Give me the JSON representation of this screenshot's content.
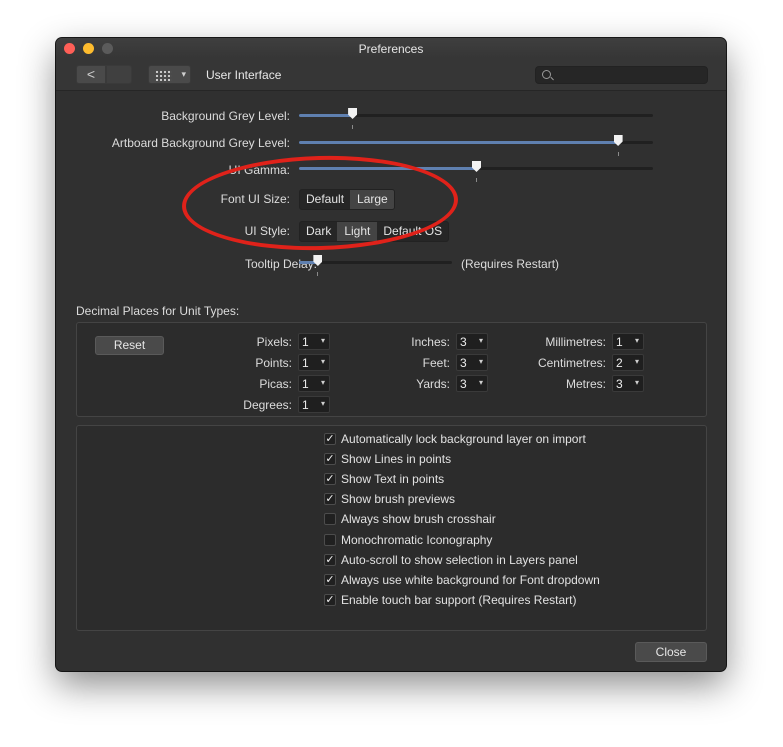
{
  "window": {
    "title": "Preferences"
  },
  "toolbar": {
    "section": "User Interface",
    "back_glyph": "<",
    "grid_caret": "▾",
    "search_placeholder": ""
  },
  "sliders": {
    "background_grey": {
      "label": "Background Grey Level:",
      "value": 0.15
    },
    "artboard_grey": {
      "label": "Artboard Background Grey Level:",
      "value": 0.9
    },
    "ui_gamma": {
      "label": "UI Gamma:",
      "value": 0.5
    },
    "tooltip_delay": {
      "label": "Tooltip Delay:",
      "value": 0.12,
      "note": "(Requires Restart)"
    }
  },
  "font_ui_size": {
    "label": "Font UI Size:",
    "options": [
      "Default",
      "Large"
    ],
    "selected": "Large"
  },
  "ui_style": {
    "label": "UI Style:",
    "options": [
      "Dark",
      "Light",
      "Default OS"
    ],
    "selected": "Light"
  },
  "decimal": {
    "title": "Decimal Places for Unit Types:",
    "reset_label": "Reset",
    "units": [
      {
        "label": "Pixels:",
        "value": "1"
      },
      {
        "label": "Points:",
        "value": "1"
      },
      {
        "label": "Picas:",
        "value": "1"
      },
      {
        "label": "Degrees:",
        "value": "1"
      },
      {
        "label": "Inches:",
        "value": "3"
      },
      {
        "label": "Feet:",
        "value": "3"
      },
      {
        "label": "Yards:",
        "value": "3"
      },
      {
        "label": "Millimetres:",
        "value": "1"
      },
      {
        "label": "Centimetres:",
        "value": "2"
      },
      {
        "label": "Metres:",
        "value": "3"
      }
    ],
    "caret": "▾"
  },
  "options": [
    {
      "label": "Automatically lock background layer on import",
      "checked": true
    },
    {
      "label": "Show Lines in points",
      "checked": true
    },
    {
      "label": "Show Text in points",
      "checked": true
    },
    {
      "label": "Show brush previews",
      "checked": true
    },
    {
      "label": "Always show brush crosshair",
      "checked": false
    },
    {
      "label": "Monochromatic Iconography",
      "checked": false
    },
    {
      "label": "Auto-scroll to show selection in Layers panel",
      "checked": true
    },
    {
      "label": "Always use white background for Font dropdown",
      "checked": true
    },
    {
      "label": "Enable touch bar support (Requires Restart)",
      "checked": true
    }
  ],
  "checkmark": "✓",
  "footer": {
    "close_label": "Close"
  },
  "annotation": {
    "color": "#e0221a"
  },
  "colors": {
    "window_bg": "#303030",
    "accent_fill": "#5f80b0"
  }
}
